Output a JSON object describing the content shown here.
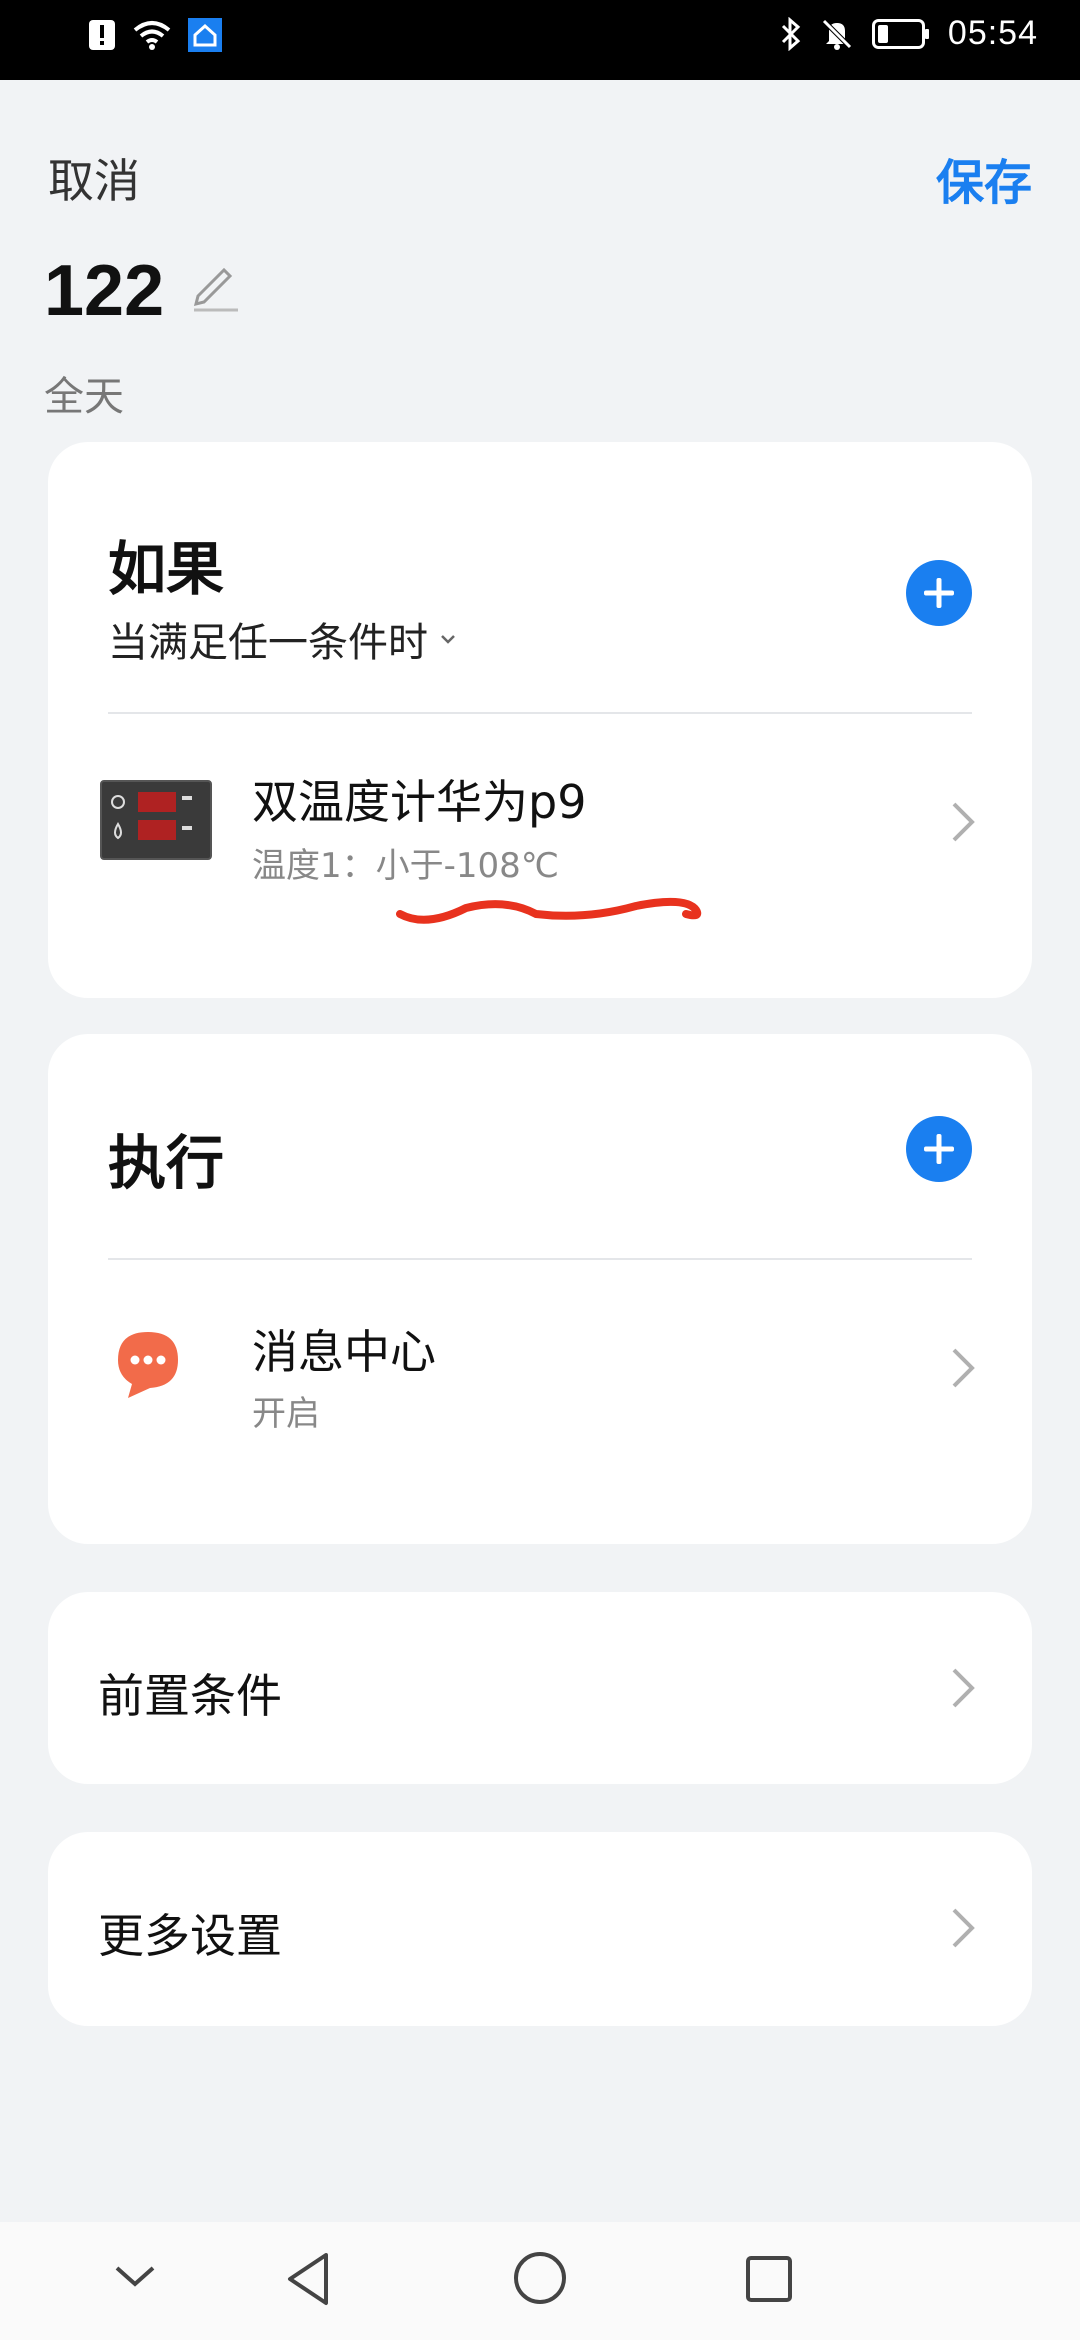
{
  "status": {
    "time": "05:54"
  },
  "header": {
    "cancel_label": "取消",
    "save_label": "保存",
    "scene_name": "122",
    "schedule": "全天"
  },
  "if_section": {
    "title": "如果",
    "mode_label": "当满足任一条件时",
    "condition": {
      "title": "双温度计华为p9",
      "subtitle": "温度1：小于-108℃"
    }
  },
  "do_section": {
    "title": "执行",
    "action": {
      "title": "消息中心",
      "subtitle": "开启"
    }
  },
  "precondition_label": "前置条件",
  "more_settings_label": "更多设置",
  "colors": {
    "accent": "#1a7ff0",
    "message_icon": "#f26b4a",
    "annotation": "#e8321e"
  }
}
